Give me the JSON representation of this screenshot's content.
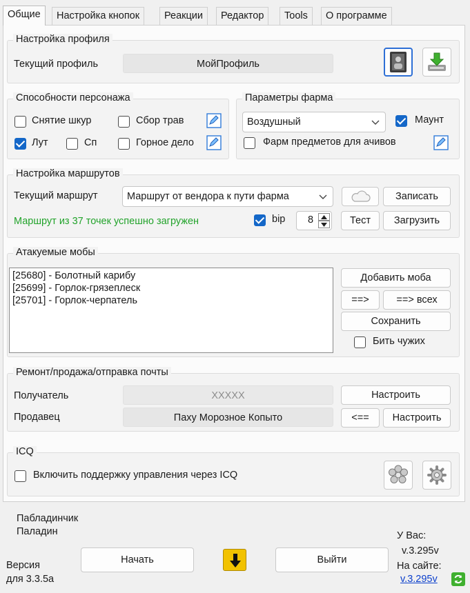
{
  "tabs": [
    "Общие",
    "Настройка кнопок",
    "Реакции",
    "Редактор",
    "Tools",
    "О программе"
  ],
  "profile": {
    "legend": "Настройка профиля",
    "label": "Текущий профиль",
    "value": "МойПрофиль",
    "icons": [
      "profile-card-icon",
      "download-icon"
    ]
  },
  "abilities": {
    "legend": "Способности персонажа",
    "items": [
      {
        "label": "Снятие шкур",
        "checked": false
      },
      {
        "label": "Сбор трав",
        "checked": false
      },
      {
        "label": "Лут",
        "checked": true
      },
      {
        "label": "Сп",
        "checked": false
      },
      {
        "label": "Горное дело",
        "checked": false
      }
    ]
  },
  "farm": {
    "legend": "Параметры фарма",
    "mode": "Воздушный",
    "mount_label": "Маунт",
    "mount_checked": true,
    "achiev_label": "Фарм предметов для ачивов",
    "achiev_checked": false
  },
  "route": {
    "legend": "Настройка маршрутов",
    "label": "Текущий маршрут",
    "value": "Маршрут от вендора к пути фарма",
    "status": "Маршрут из 37 точек успешно загружен",
    "bip_label": "bip",
    "bip_checked": true,
    "spin_value": "8",
    "record": "Записать",
    "test": "Тест",
    "load": "Загрузить"
  },
  "mobs": {
    "legend": "Атакуемые мобы",
    "list": [
      "[25680] - Болотный карибу",
      "[25699] - Горлок-грязеплеск",
      "[25701] - Горлок-черпатель"
    ],
    "add": "Добавить моба",
    "move": "==>",
    "move_all": "==> всех",
    "save": "Сохранить",
    "beat_others": "Бить чужих",
    "beat_checked": false
  },
  "repair": {
    "legend": "Ремонт/продажа/отправка почты",
    "recipient_label": "Получатель",
    "recipient_value": "XXXXX",
    "seller_label": "Продавец",
    "seller_value": "Паху Морозное Копыто",
    "configure": "Настроить",
    "back": "<=="
  },
  "icq": {
    "legend": "ICQ",
    "enable_label": "Включить поддержку управления через ICQ",
    "checked": false,
    "icons": [
      "flower-icon",
      "gear-icon"
    ]
  },
  "footer": {
    "char_name": "Пабладинчик",
    "char_class": "Паладин",
    "version_label": "Версия",
    "version_for": "для 3.3.5a",
    "start": "Начать",
    "exit": "Выйти",
    "you_have": "У Вас:",
    "local_version": "v.3.295v",
    "on_site": "На сайте:",
    "site_version": "v.3.295v"
  },
  "colors": {
    "accent": "#1467c8",
    "status_green": "#22a32b",
    "link": "#0b3fcc",
    "arrow": "#f2c200"
  }
}
